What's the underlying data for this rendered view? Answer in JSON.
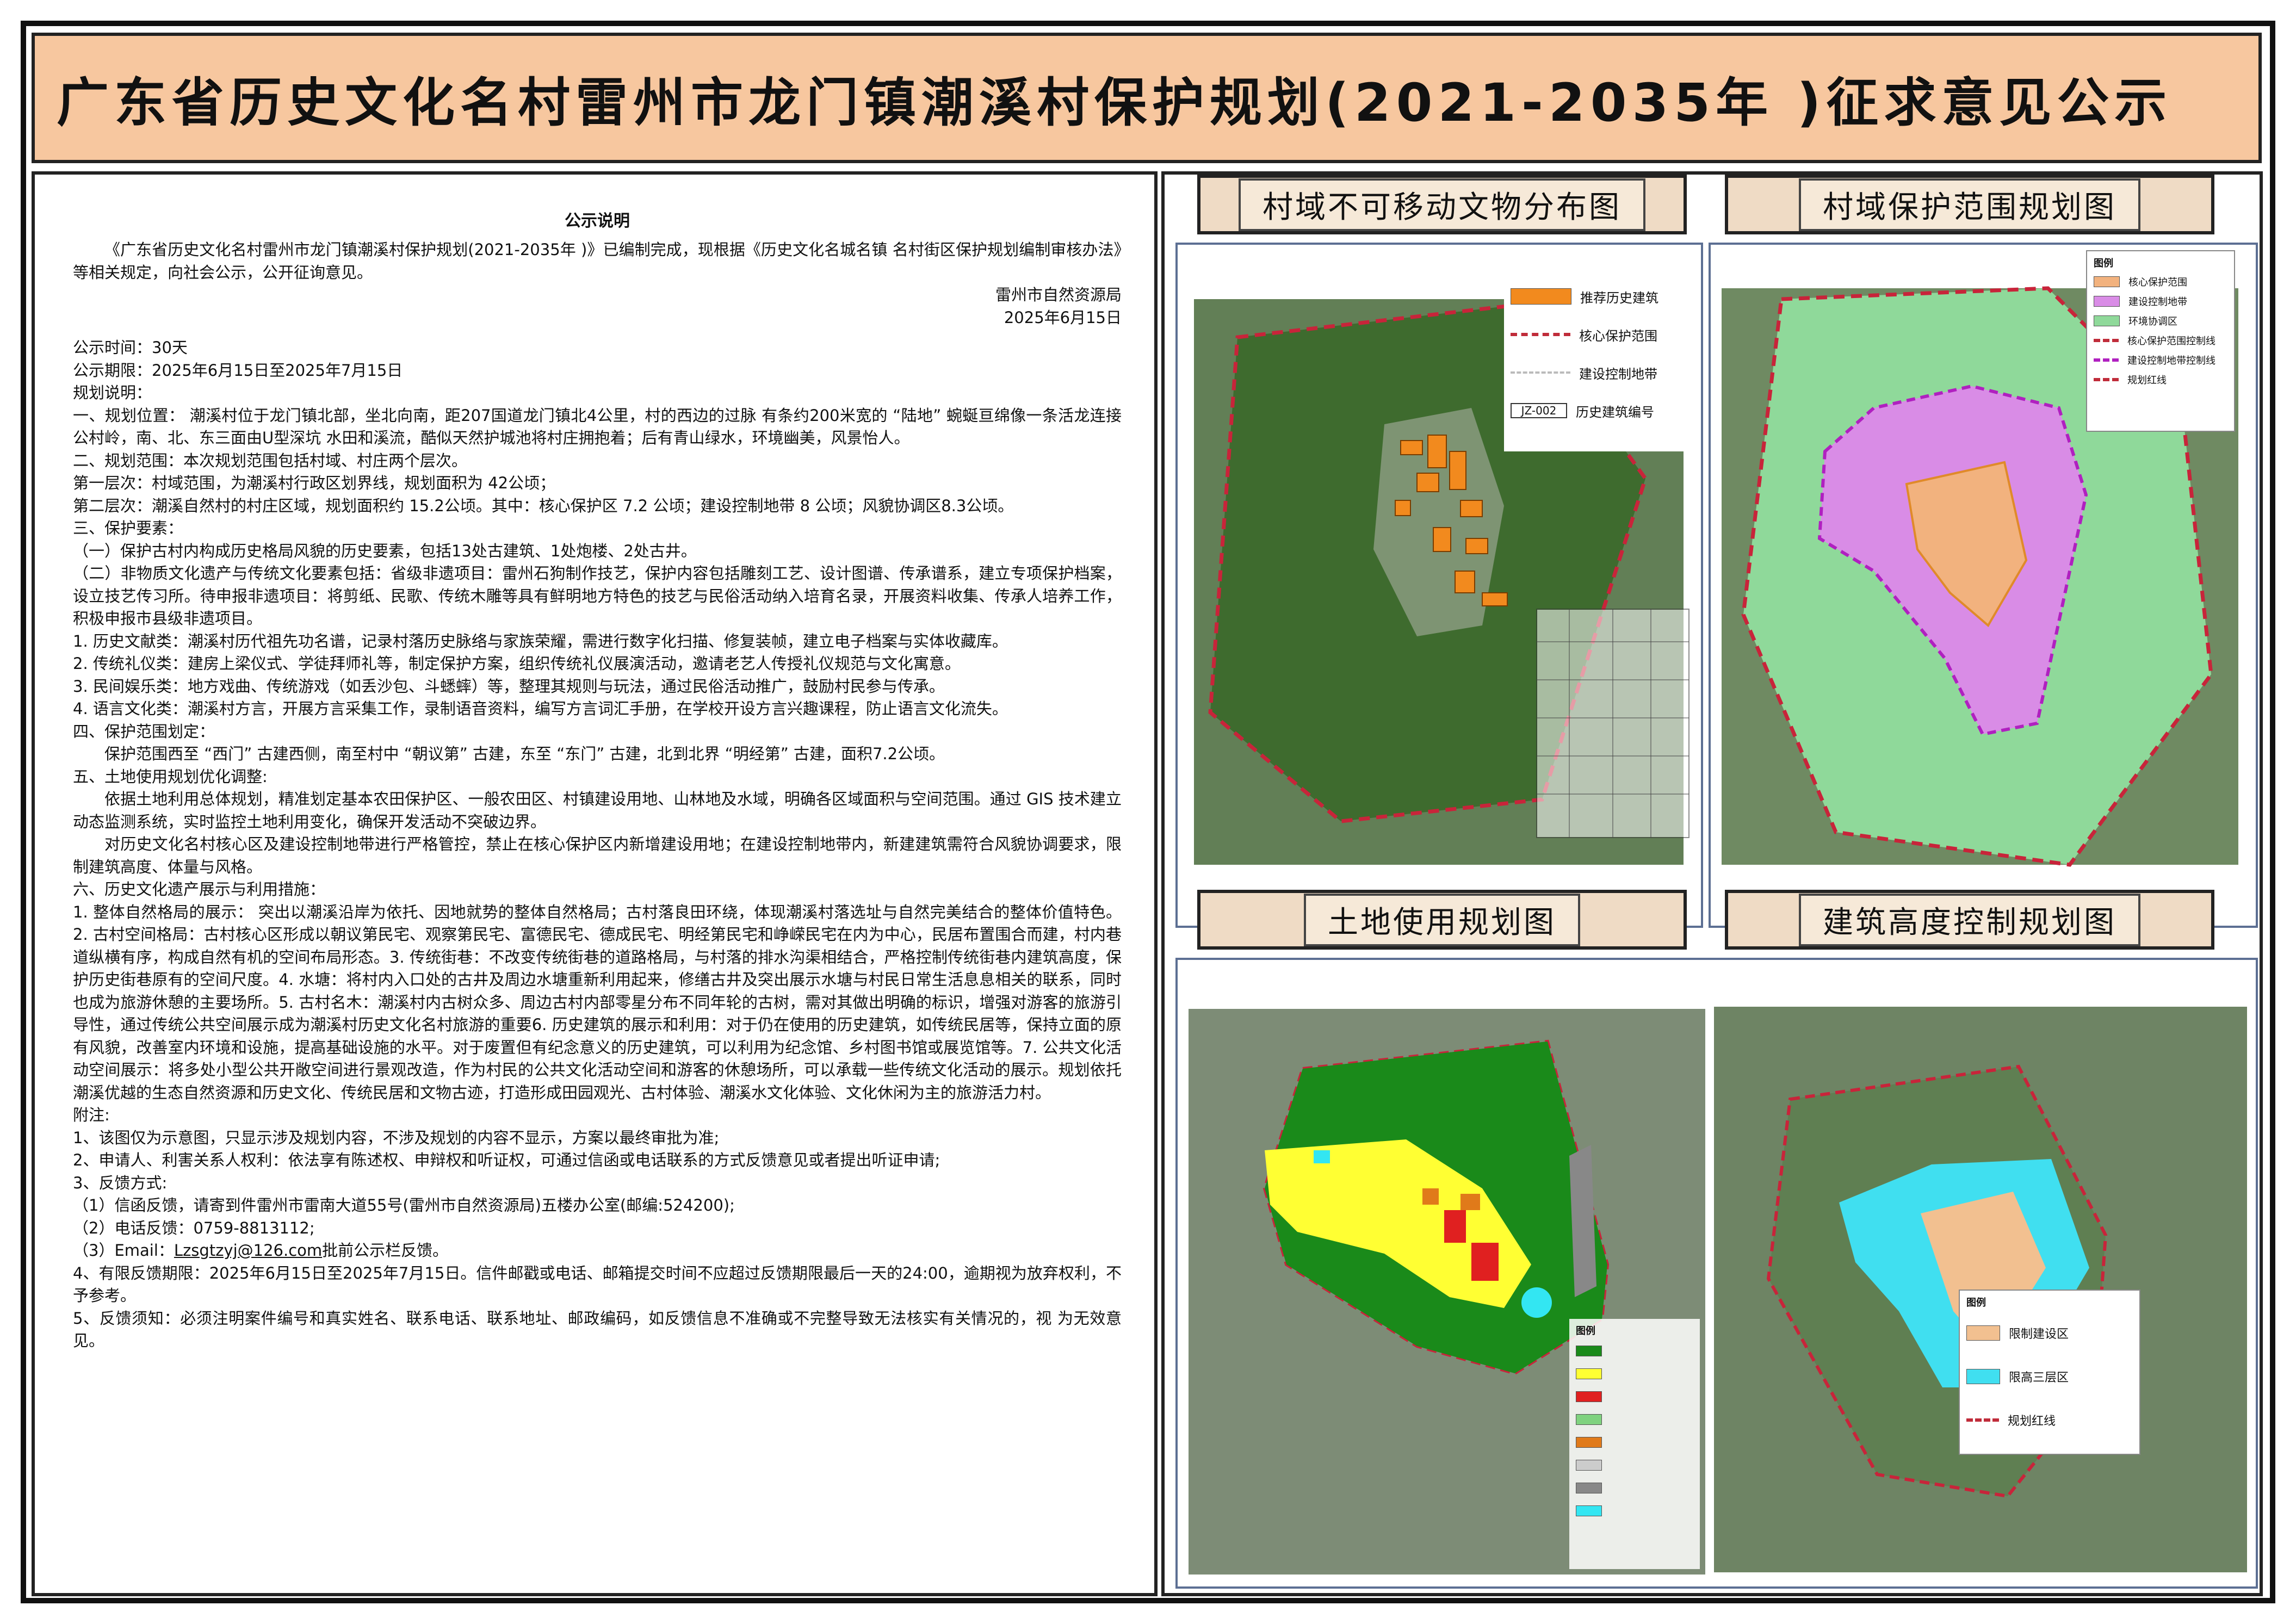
{
  "header": {
    "title": "广东省历史文化名村雷州市龙门镇潮溪村保护规划(2021-2035年 )征求意见公示"
  },
  "notice": {
    "heading": "公示说明",
    "intro": "《广东省历史文化名村雷州市龙门镇潮溪村保护规划(2021-2035年 )》已编制完成，现根据《历史文化名城名镇 名村街区保护规划编制审核办法》等相关规定，向社会公示，公开征询意见。",
    "issuer": "雷州市自然资源局",
    "date": "2025年6月15日",
    "lines": [
      "公示时间：30天",
      "公示期限：2025年6月15日至2025年7月15日",
      "规划说明：",
      "一、规划位置： 潮溪村位于龙门镇北部，坐北向南，距207国道龙门镇北4公里，村的西边的过脉 有条约200米宽的 “陆地” 蜿蜒亘绵像一条活龙连接公村岭，南、北、东三面由U型深坑 水田和溪流，酷似天然护城池将村庄拥抱着；后有青山绿水，环境幽美，风景怡人。",
      "二、规划范围：本次规划范围包括村域、村庄两个层次。",
      "第一层次：村域范围，为潮溪村行政区划界线，规划面积为 42公顷；",
      "第二层次：潮溪自然村的村庄区域，规划面积约 15.2公顷。其中：核心保护区 7.2 公顷；建设控制地带 8 公顷；风貌协调区8.3公顷。",
      "三、保护要素：",
      "（一）保护古村内构成历史格局风貌的历史要素，包括13处古建筑、1处炮楼、2处古井。",
      "（二）非物质文化遗产与传统文化要素包括：省级非遗项目：雷州石狗制作技艺，保护内容包括雕刻工艺、设计图谱、传承谱系，建立专项保护档案，设立技艺传习所。待申报非遗项目：将剪纸、民歌、传统木雕等具有鲜明地方特色的技艺与民俗活动纳入培育名录，开展资料收集、传承人培养工作，积极申报市县级非遗项目。",
      "1. 历史文献类：潮溪村历代祖先功名谱，记录村落历史脉络与家族荣耀，需进行数字化扫描、修复装帧，建立电子档案与实体收藏库。",
      "2. 传统礼仪类：建房上梁仪式、学徒拜师礼等，制定保护方案，组织传统礼仪展演活动，邀请老艺人传授礼仪规范与文化寓意。",
      "3. 民间娱乐类：地方戏曲、传统游戏（如丢沙包、斗蟋蟀）等，整理其规则与玩法，通过民俗活动推广，鼓励村民参与传承。",
      "4. 语言文化类：潮溪村方言，开展方言采集工作，录制语音资料，编写方言词汇手册，在学校开设方言兴趣课程，防止语言文化流失。",
      "四、保护范围划定："
    ],
    "scope": "保护范围西至 “西门” 古建西侧，南至村中 “朝议第” 古建，东至 “东门” 古建，北到北界 “明经第” 古建，面积7.2公顷。",
    "land_heading": "五、土地使用规划优化调整:",
    "land_p1": "依据土地利用总体规划，精准划定基本农田保护区、一般农田区、村镇建设用地、山林地及水域，明确各区域面积与空间范围。通过 GIS 技术建立动态监测系统，实时监控土地利用变化，确保开发活动不突破边界。",
    "land_p2": "对历史文化名村核心区及建设控制地带进行严格管控，禁止在核心保护区内新增建设用地；在建设控制地带内，新建建筑需符合风貌协调要求，限制建筑高度、体量与风格。",
    "display_heading": "六、历史文化遗产展示与利用措施：",
    "display_p": "1. 整体自然格局的展示： 突出以潮溪沿岸为依托、因地就势的整体自然格局；古村落良田环绕，体现潮溪村落选址与自然完美结合的整体价值特色。2. 古村空间格局：古村核心区形成以朝议第民宅、观察第民宅、富德民宅、德成民宅、明经第民宅和峥嵘民宅在内为中心，民居布置围合而建，村内巷道纵横有序，构成自然有机的空间布局形态。3. 传统街巷：不改变传统街巷的道路格局，与村落的排水沟渠相结合，严格控制传统街巷内建筑高度，保护历史街巷原有的空间尺度。4. 水塘：将村内入口处的古井及周边水塘重新利用起来，修缮古井及突出展示水塘与村民日常生活息息相关的联系，同时也成为旅游休憩的主要场所。5. 古村名木：潮溪村内古树众多、周边古村内部零星分布不同年轮的古树，需对其做出明确的标识，增强对游客的旅游引导性，通过传统公共空间展示成为潮溪村历史文化名村旅游的重要6. 历史建筑的展示和利用：对于仍在使用的历史建筑，如传统民居等，保持立面的原有风貌，改善室内环境和设施，提高基础设施的水平。对于废置但有纪念意义的历史建筑，可以利用为纪念馆、乡村图书馆或展览馆等。7. 公共文化活动空间展示：将多处小型公共开敞空间进行景观改造，作为村民的公共文化活动空间和游客的休憩场所，可以承载一些传统文化活动的展示。规划依托潮溪优越的生态自然资源和历史文化、传统民居和文物古迹，打造形成田园观光、古村体验、潮溪水文化体验、文化休闲为主的旅游活力村。",
    "notes": [
      "附注:",
      "1、该图仅为示意图，只显示涉及规划内容，不涉及规划的内容不显示，方案以最终审批为准;",
      "2、申请人、利害关系人权利：依法享有陈述权、申辩权和听证权，可通过信函或电话联系的方式反馈意见或者提出听证申请;",
      "3、反馈方式:",
      "（1）信函反馈，请寄到件雷州市雷南大道55号(雷州市自然资源局)五楼办公室(邮编:524200);",
      "（2）电话反馈：0759-8813112;"
    ],
    "email_prefix": "（3）Email：",
    "email": "Lzsgtzyj@126.com",
    "email_suffix": "批前公示栏反馈。",
    "notes2": [
      "4、有限反馈期限：2025年6月15日至2025年7月15日。信件邮戳或电话、邮箱提交时间不应超过反馈期限最后一天的24:00，逾期视为放弃权利，不予参考。",
      "5、反馈须知：必须注明案件编号和真实姓名、联系电话、联系地址、邮政编码，如反馈信息不准确或不完整导致无法核实有关情况的，视 为无效意见。"
    ]
  },
  "maps": {
    "m1": {
      "title": "村域不可移动文物分布图",
      "legend": [
        "推荐历史建筑",
        "核心保护范围",
        "建设控制地带",
        "历史建筑编号"
      ],
      "code": "JZ-002",
      "colors": {
        "building": "#f28a1e",
        "red": "#c8243a"
      }
    },
    "m2": {
      "title": "村域保护范围规划图",
      "legend_title": "图例",
      "legend": [
        "核心保护范围",
        "建设控制地带",
        "环境协调区",
        "核心保护范围控制线",
        "建设控制地带控制线",
        "规划红线"
      ],
      "colors": {
        "core": "#f2b27e",
        "control": "#d98ce6",
        "env": "#8fd99a"
      }
    },
    "m3": {
      "title": "土地使用规划图",
      "legend_title": "图例",
      "colors": [
        "#1a8a1a",
        "#ffff33",
        "#e02020",
        "#7fd27f",
        "#e07a1a",
        "#cccccc",
        "#888888",
        "#33e6f2"
      ]
    },
    "m4": {
      "title": "建筑高度控制规划图",
      "legend_title": "图例",
      "legend": [
        "限制建设区",
        "限高三层区",
        "规划红线"
      ],
      "colors": {
        "limit": "#f2c090",
        "three": "#40dff0"
      }
    }
  }
}
